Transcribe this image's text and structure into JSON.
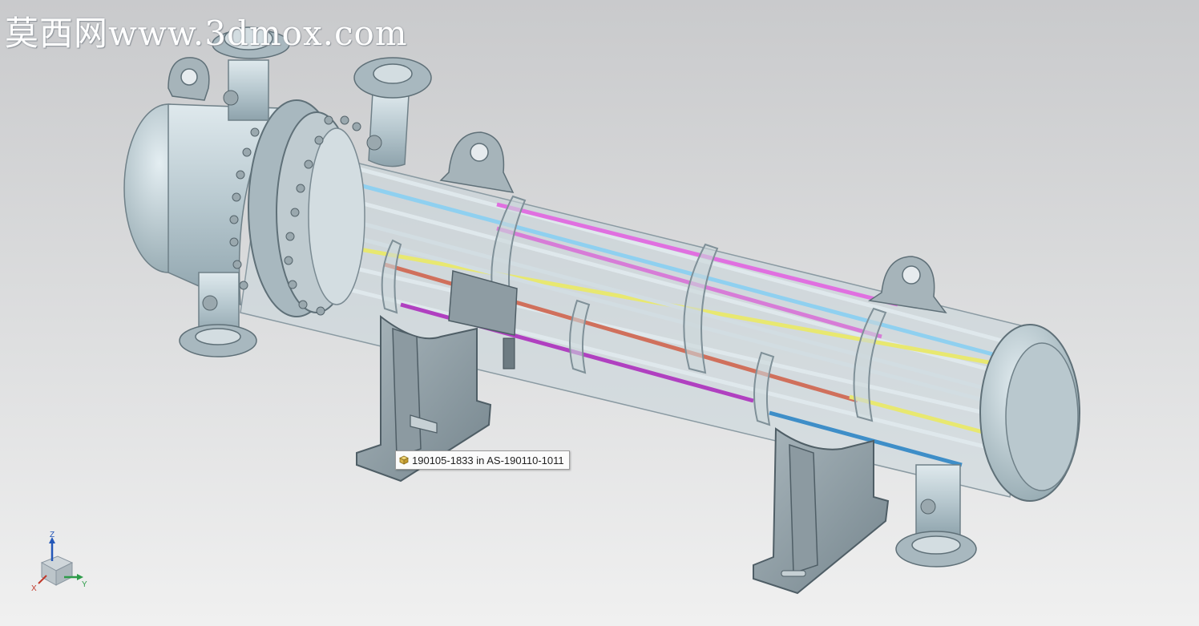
{
  "watermark": {
    "text": "莫西网www.3dmox.com"
  },
  "tooltip": {
    "icon": "part-cube-icon",
    "text": "190105-1833 in AS-190110-1011"
  },
  "triad": {
    "x_label": "X",
    "y_label": "Y",
    "z_label": "Z",
    "x_color": "#c0392b",
    "y_color": "#2e9c4a",
    "z_color": "#2457b8"
  },
  "model": {
    "shell_color": "#b8c7cd",
    "tube_colors": [
      "#8fd0f0",
      "#e070e0",
      "#e8e870",
      "#d0705c",
      "#b040c0",
      "#3e8ec8"
    ]
  }
}
